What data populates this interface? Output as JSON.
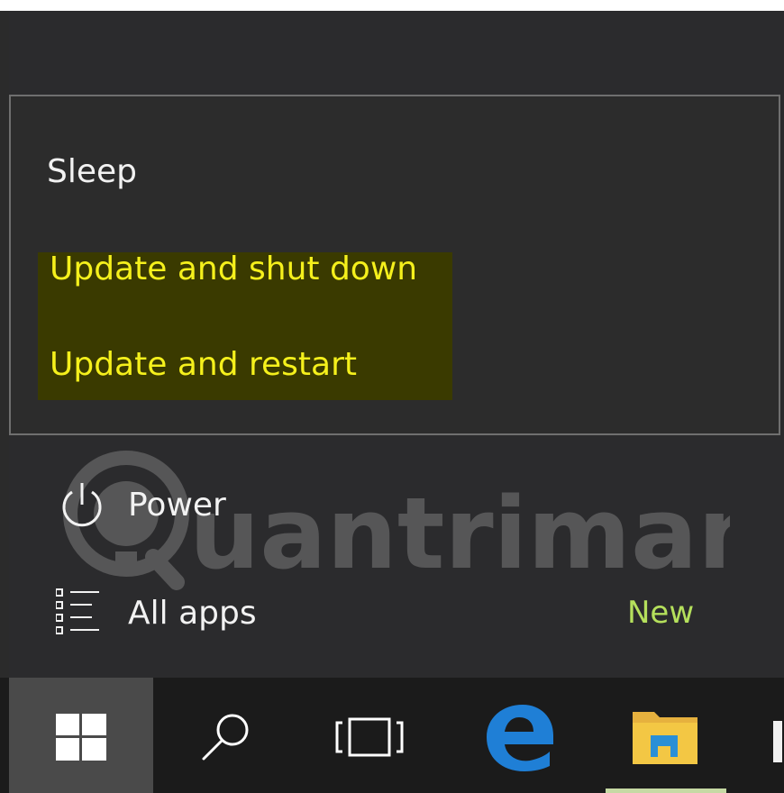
{
  "power_menu": {
    "items": [
      {
        "label": "Sleep"
      },
      {
        "label": "Update and shut down"
      },
      {
        "label": "Update and restart"
      }
    ]
  },
  "start_menu": {
    "power_label": "Power",
    "all_apps_label": "All apps",
    "new_badge": "New"
  },
  "watermark": {
    "text": "uantrimang"
  },
  "colors": {
    "highlight_text": "#f5f01c",
    "new_text": "#b5e05c",
    "edge_blue": "#1f7fd6",
    "folder_yellow": "#f3c744"
  },
  "taskbar": {
    "buttons": [
      {
        "icon": "windows-logo-icon"
      },
      {
        "icon": "search-icon"
      },
      {
        "icon": "task-view-icon"
      },
      {
        "icon": "edge-icon"
      },
      {
        "icon": "file-explorer-icon"
      }
    ]
  }
}
